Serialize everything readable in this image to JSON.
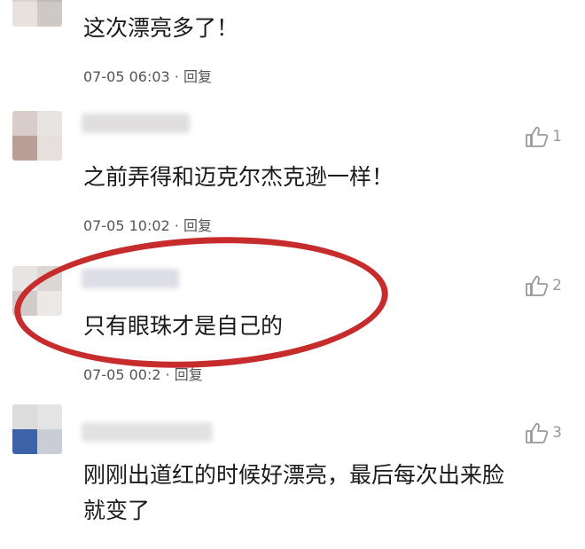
{
  "comments": [
    {
      "text": "这次漂亮多了！",
      "time": "07-05 06:03",
      "sep": "·",
      "reply": "回复",
      "likes": ""
    },
    {
      "text": "之前弄得和迈克尔杰克逊一样！",
      "time": "07-05 10:02",
      "sep": "·",
      "reply": "回复",
      "likes": "1"
    },
    {
      "text": "只有眼珠才是自己的",
      "time": "07-05 00:2",
      "sep": "·",
      "reply": "回复",
      "likes": "2"
    },
    {
      "text_line1": "刚刚出道红的时候好漂亮，最后每次出来脸",
      "text_line2": "就变了",
      "likes": "3"
    }
  ],
  "colors": {
    "highlight": "#c72c2c",
    "like_icon": "#999999",
    "meta_text": "#555555"
  },
  "icons": {
    "like": "thumbs-up-icon"
  }
}
